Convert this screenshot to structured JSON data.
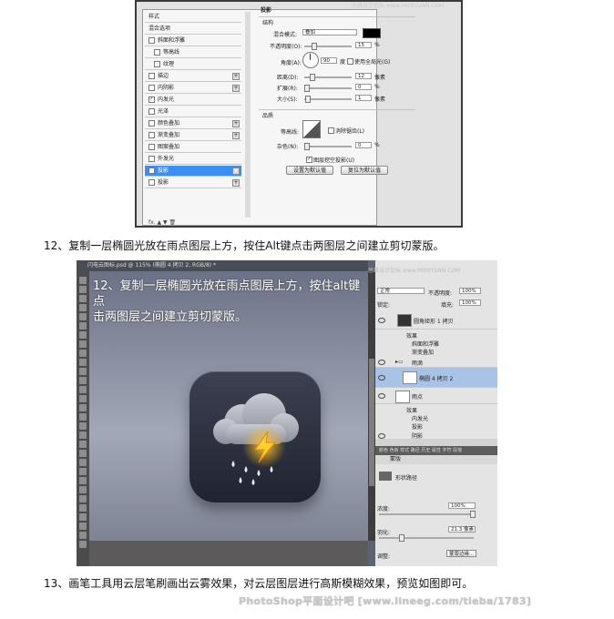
{
  "dialog": {
    "watermark": "思缘设计论坛 www.MISSYUAN.COM",
    "styles_header": "样式",
    "blend_options": "混合选项",
    "style_rows": [
      {
        "label": "斜面和浮雕",
        "checked": false,
        "plus": false
      },
      {
        "label": "等高线",
        "checked": false,
        "plus": false,
        "indent": true
      },
      {
        "label": "纹理",
        "checked": false,
        "plus": false,
        "indent": true
      },
      {
        "label": "描边",
        "checked": false,
        "plus": true
      },
      {
        "label": "内阴影",
        "checked": false,
        "plus": true
      },
      {
        "label": "内发光",
        "checked": true,
        "plus": false
      },
      {
        "label": "光泽",
        "checked": false,
        "plus": false
      },
      {
        "label": "颜色叠加",
        "checked": false,
        "plus": true
      },
      {
        "label": "渐变叠加",
        "checked": false,
        "plus": true
      },
      {
        "label": "图案叠加",
        "checked": false,
        "plus": false
      },
      {
        "label": "外发光",
        "checked": false,
        "plus": false
      },
      {
        "label": "投影",
        "checked": true,
        "plus": true,
        "selected": true
      },
      {
        "label": "投影",
        "checked": false,
        "plus": true
      }
    ],
    "footer": "fx. ▲ ▼                         🗑",
    "section_title": "投影",
    "structure_title": "结构",
    "blend_mode_label": "混合模式:",
    "blend_mode_value": "叠加",
    "opacity_label": "不透明度(O):",
    "opacity_value": "15",
    "pct": "%",
    "angle_label": "角度(A):",
    "angle_value": "90",
    "degree": "度",
    "global_light": "使用全局光(G)",
    "distance_label": "距离(D):",
    "distance_value": "12",
    "px": "像素",
    "spread_label": "扩展(R):",
    "spread_value": "0",
    "size_label": "大小(S):",
    "size_value": "1",
    "quality_title": "品质",
    "contour_label": "等高线:",
    "antialias": "消除锯齿(L)",
    "noise_label": "杂色(N):",
    "noise_value": "0",
    "knockout": "图层挖空投影(U)",
    "btn_default": "设置为默认值",
    "btn_reset": "复位为默认值"
  },
  "caption12": "12、复制一层椭圆光放在雨点图层上方，按住Alt键点击两图层之间建立剪切蒙版。",
  "ps": {
    "tab_title": "闪电云图标.psd @ 115% (椭圆 4 拷贝 2, RGB/8) *",
    "overlay_line1": "12、复制一层椭圆光放在雨点图层上方，按住alt键点",
    "overlay_line2": "击两图层之间建立剪切蒙版。",
    "panel": {
      "watermark": "思缘设计论坛 www.MISSYUAN.COM",
      "blend": "正常",
      "opacity_label": "不透明度:",
      "opacity": "100%",
      "lock_label": "锁定:",
      "fill_label": "填充:",
      "fill": "100%",
      "layer1": "圆角矩形 1 拷贝",
      "effects": "效果",
      "bevel": "斜面和浮雕",
      "gradient_overlay": "渐变叠加",
      "group": "雨滴",
      "layer_selected": "椭圆 4 拷贝 2",
      "layer_rain": "雨点",
      "inner_glow": "内发光",
      "drop_shadow": "投影",
      "layer_bottom": "阴影",
      "tabs": "颜色 色板 样式 路径 历史 属性 字符 段落",
      "mask_label": "蒙版",
      "shape_path": "形状路径",
      "density_label": "浓度:",
      "density": "100%",
      "feather_label": "羽化:",
      "feather": "21.3 像素",
      "adjust_label": "调整:",
      "mask_edge": "蒙版边缘..."
    }
  },
  "caption13": "13、画笔工具用云层笔刷画出云雾效果，对云层图层进行高斯模糊效果，预览如图即可。",
  "site_watermark": "PhotoShop平面设计吧 [www.lineeg.com/tieba/1783]"
}
